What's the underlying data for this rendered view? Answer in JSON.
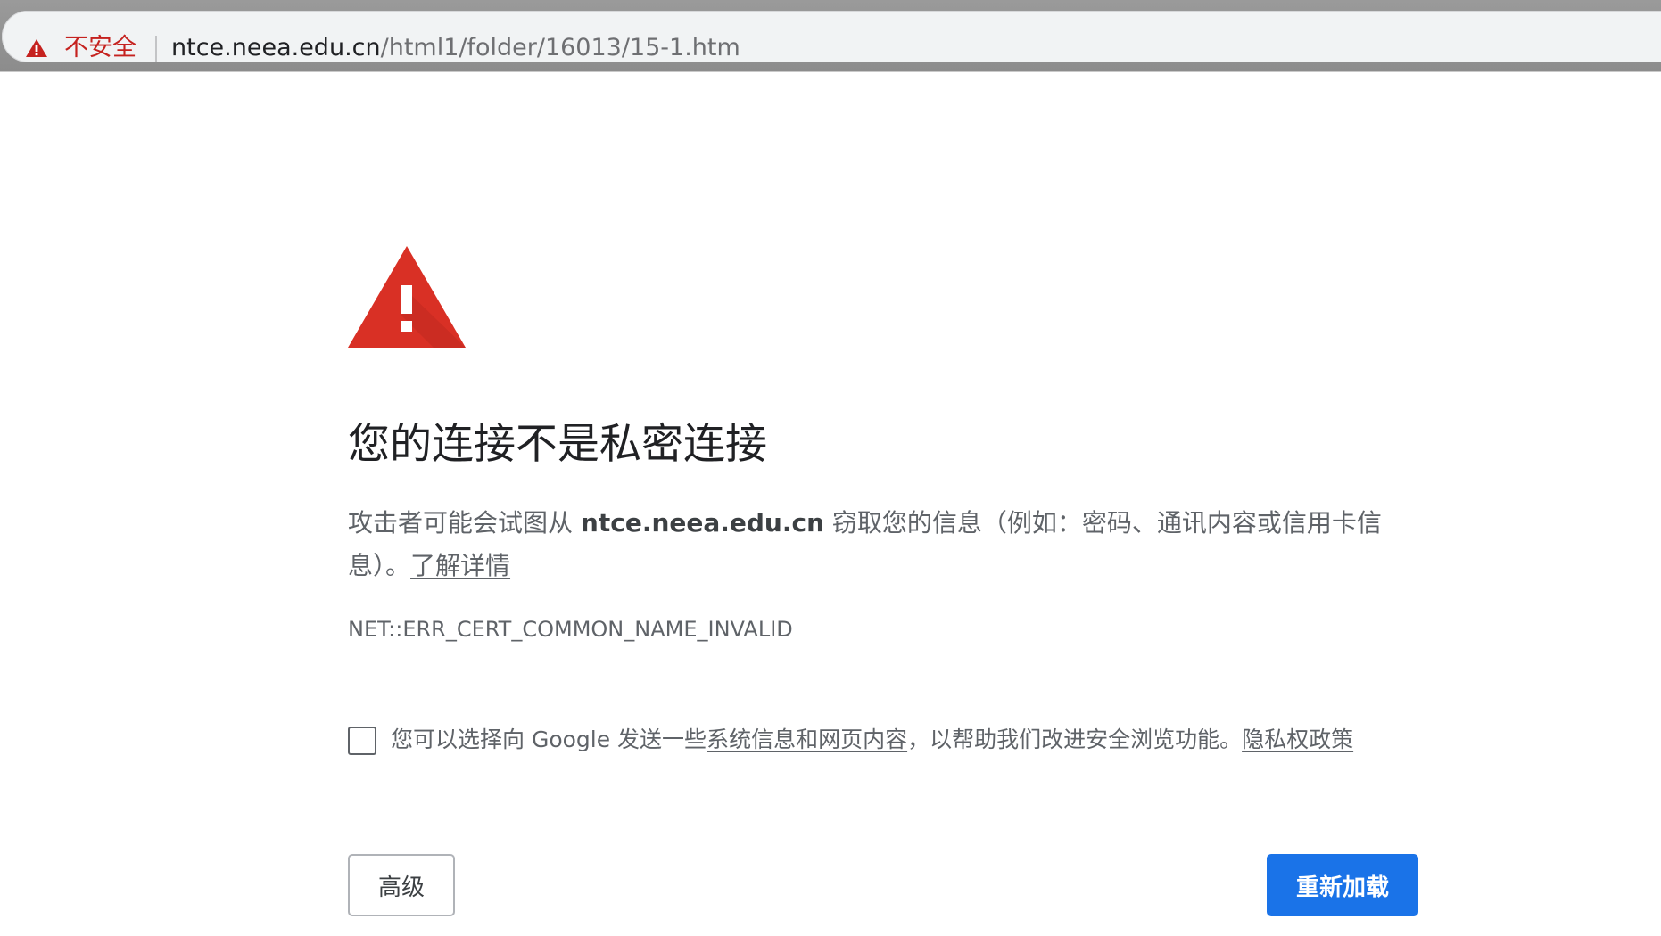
{
  "address_bar": {
    "security_label": "不安全",
    "url_host": "ntce.neea.edu.cn",
    "url_path": "/html1/folder/16013/15-1.htm"
  },
  "interstitial": {
    "heading": "您的连接不是私密连接",
    "explanation_prefix": "攻击者可能会试图从 ",
    "explanation_host": "ntce.neea.edu.cn",
    "explanation_suffix": " 窃取您的信息（例如：密码、通讯内容或信用卡信息）。",
    "learn_more_link": "了解详情",
    "error_code": "NET::ERR_CERT_COMMON_NAME_INVALID",
    "optin": {
      "checked": false,
      "text_prefix": "您可以选择向 Google 发送一些",
      "link_system_info": "系统信息和网页内容",
      "text_middle": "，以帮助我们改进安全浏览功能。",
      "link_privacy": "隐私权政策"
    },
    "advanced_button": "高级",
    "reload_button": "重新加载"
  },
  "colors": {
    "danger_red": "#d93025",
    "insecure_text": "#c5221f",
    "primary_button": "#1a73e8"
  },
  "icons": {
    "address_warning": "warning-triangle-icon",
    "main_warning": "warning-triangle-icon"
  }
}
